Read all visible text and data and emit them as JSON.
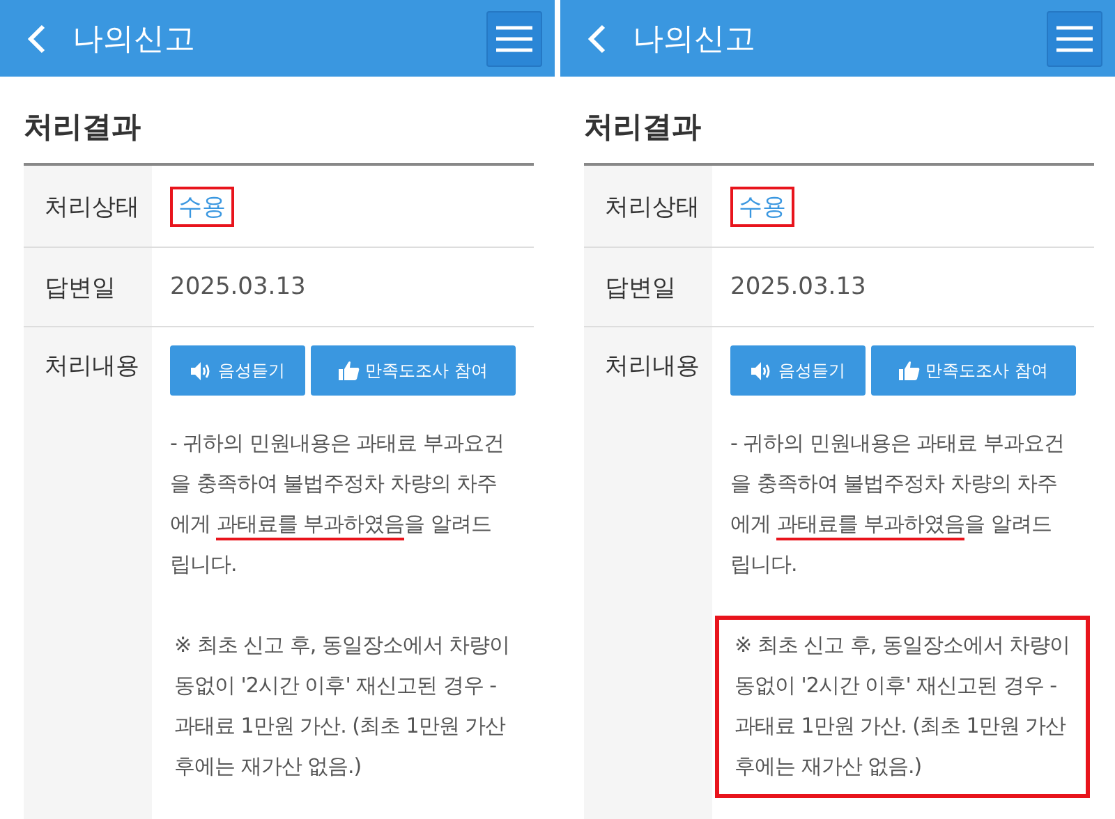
{
  "panels": [
    {
      "header": {
        "title": "나의신고"
      },
      "section_title": "처리결과",
      "status": {
        "label": "처리상태",
        "value": "수용",
        "boxed": true
      },
      "answer_date": {
        "label": "답변일",
        "value": "2025.03.13"
      },
      "content": {
        "label": "처리내용",
        "buttons": [
          {
            "kind": "listen",
            "label": "음성듣기"
          },
          {
            "kind": "survey",
            "label": "만족도조사 참여"
          }
        ],
        "paragraph": {
          "before": "- 귀하의 민원내용은 과태료 부과요건을 충족하여 불법주정차 차량의 차주에게 ",
          "underlined": "과태료를 부과하였음",
          "after": "을 알려드립니다.",
          "underline_marked": true
        },
        "note": {
          "text": "※ 최초 신고 후, 동일장소에서 차량이동없이 '2시간 이후' 재신고된 경우 - 과태료 1만원 가산. (최초 1만원 가산 후에는 재가산 없음.)",
          "boxed": false
        }
      }
    },
    {
      "header": {
        "title": "나의신고"
      },
      "section_title": "처리결과",
      "status": {
        "label": "처리상태",
        "value": "수용",
        "boxed": true
      },
      "answer_date": {
        "label": "답변일",
        "value": "2025.03.13"
      },
      "content": {
        "label": "처리내용",
        "buttons": [
          {
            "kind": "listen",
            "label": "음성듣기"
          },
          {
            "kind": "survey",
            "label": "만족도조사 참여"
          }
        ],
        "paragraph": {
          "before": "- 귀하의 민원내용은 과태료 부과요건을 충족하여 불법주정차 차량의 차주에게 ",
          "underlined": "과태료를 부과하였음",
          "after": "을 알려드립니다.",
          "underline_marked": true
        },
        "note": {
          "text": "※ 최초 신고 후, 동일장소에서 차량이동없이 '2시간 이후' 재신고된 경우 - 과태료 1만원 가산. (최초 1만원 가산 후에는 재가산 없음.)",
          "boxed": true
        }
      }
    }
  ]
}
